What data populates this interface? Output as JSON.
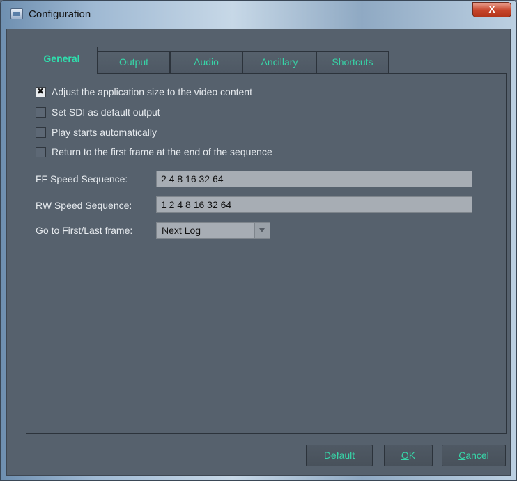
{
  "window": {
    "title": "Configuration",
    "close_glyph": "X",
    "icon": "app-window-icon"
  },
  "tabs": [
    {
      "label": "General",
      "active": true
    },
    {
      "label": "Output",
      "active": false
    },
    {
      "label": "Audio",
      "active": false
    },
    {
      "label": "Ancillary",
      "active": false
    },
    {
      "label": "Shortcuts",
      "active": false
    }
  ],
  "general": {
    "checkboxes": [
      {
        "label": "Adjust the application size to the video content",
        "checked": true
      },
      {
        "label": "Set SDI as default output",
        "checked": false
      },
      {
        "label": "Play starts automatically",
        "checked": false
      },
      {
        "label": "Return to the first frame at the end of the sequence",
        "checked": false
      }
    ],
    "ff_speed": {
      "label": "FF Speed Sequence:",
      "value": "2 4 8 16 32 64"
    },
    "rw_speed": {
      "label": "RW Speed Sequence:",
      "value": "1 2 4 8 16 32 64"
    },
    "goto_frame": {
      "label": "Go to First/Last frame:",
      "value": "Next Log"
    }
  },
  "buttons": {
    "default": "Default",
    "ok_mnemonic": "O",
    "ok_rest": "K",
    "cancel_mnemonic": "C",
    "cancel_rest": "ancel"
  },
  "colors": {
    "accent": "#37d5a8",
    "background": "#56616d",
    "field": "#a7adb4",
    "close": "#c6442a"
  }
}
